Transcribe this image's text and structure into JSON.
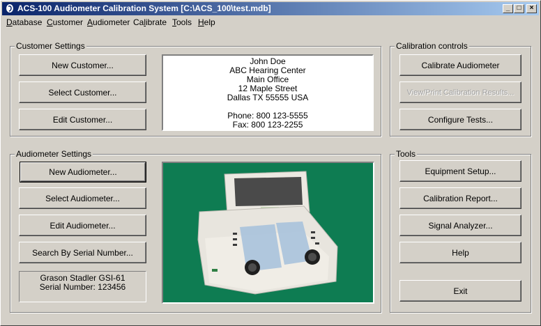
{
  "window": {
    "title": "ACS-100 Audiometer Calibration System [C:\\ACS_100\\test.mdb]",
    "controls": [
      "minimize-icon",
      "maximize-icon",
      "close-icon"
    ]
  },
  "menu": [
    {
      "label": "Database",
      "accel": "D"
    },
    {
      "label": "Customer",
      "accel": "C"
    },
    {
      "label": "Audiometer",
      "accel": "A"
    },
    {
      "label": "Calibrate",
      "accel": "l"
    },
    {
      "label": "Tools",
      "accel": "T"
    },
    {
      "label": "Help",
      "accel": "H"
    }
  ],
  "customer_settings": {
    "title": "Customer Settings",
    "buttons": [
      "New Customer...",
      "Select Customer...",
      "Edit Customer..."
    ],
    "info": [
      "John Doe",
      "ABC Hearing Center",
      "Main Office",
      "12 Maple Street",
      "Dallas TX 55555 USA",
      "",
      "Phone: 800 123-5555",
      "Fax: 800 123-2255"
    ]
  },
  "calibration_controls": {
    "title": "Calibration controls",
    "buttons": [
      "Calibrate Audiometer",
      "View/Print Calibration Results...",
      "Configure Tests..."
    ]
  },
  "audiometer_settings": {
    "title": "Audiometer Settings",
    "buttons": [
      "New Audiometer...",
      "Select Audiometer...",
      "Edit Audiometer...",
      "Search By Serial Number..."
    ],
    "model": "Grason Stadler GSI-61",
    "serial": "Serial Number: 123456",
    "photo_colors": {
      "background": "#0e7c52",
      "device": "#e6e2da"
    }
  },
  "tools": {
    "title": "Tools",
    "buttons": [
      "Equipment Setup...",
      "Calibration Report...",
      "Signal Analyzer...",
      "Help",
      "Exit"
    ]
  }
}
